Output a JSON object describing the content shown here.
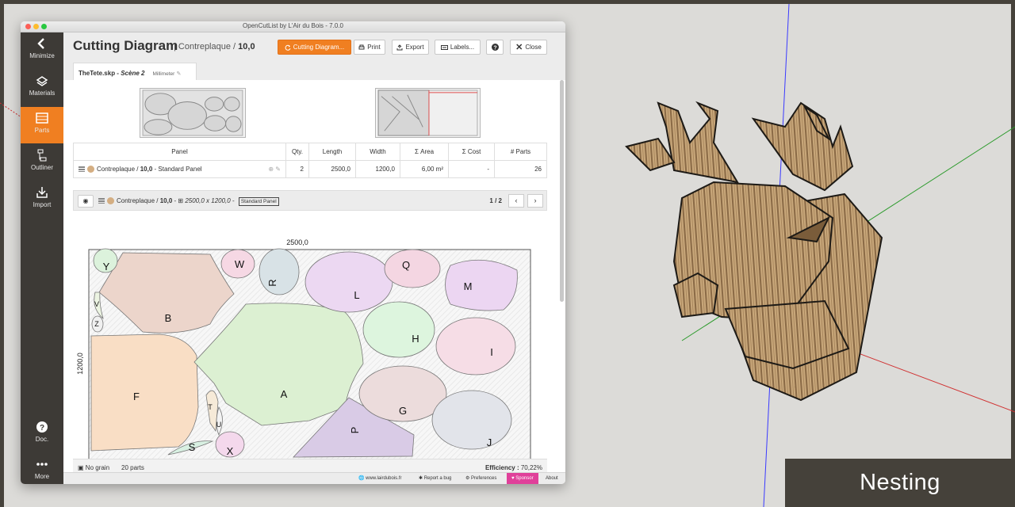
{
  "window": {
    "title": "OpenCutList by L'Air du Bois - 7.0.0"
  },
  "sidebar": [
    {
      "label": "Minimize",
      "icon": "chevron-left-icon"
    },
    {
      "label": "Materials",
      "icon": "materials-icon"
    },
    {
      "label": "Parts",
      "icon": "parts-list-icon",
      "active": true
    },
    {
      "label": "Outliner",
      "icon": "outliner-icon"
    },
    {
      "label": "Import",
      "icon": "import-icon"
    },
    {
      "label": "Doc.",
      "icon": "help-icon"
    },
    {
      "label": "More",
      "icon": "more-icon"
    }
  ],
  "header": {
    "title": "Cutting Diagram",
    "material": "Contreplaque",
    "thickness": "10,0",
    "buttons": {
      "cutting": "Cutting Diagram...",
      "print": "Print",
      "export": "Export",
      "labels": "Labels...",
      "help": "?",
      "close": "Close"
    }
  },
  "tab": {
    "file": "TheTete.skp -",
    "scene": "Scène 2",
    "unit": "Millimeter"
  },
  "summary": {
    "columns": [
      "Panel",
      "Qty.",
      "Length",
      "Width",
      "Σ Area",
      "Σ Cost",
      "# Parts"
    ],
    "row": {
      "material": "Contreplaque",
      "thickness": "10,0",
      "type": "Standard Panel",
      "qty": "2",
      "length": "2500,0",
      "width": "1200,0",
      "area": "6,00 m²",
      "cost": "-",
      "parts": "26"
    }
  },
  "sheet": {
    "material": "Contreplaque",
    "thickness": "10,0",
    "dims": "2500,0 x 1200,0",
    "type": "Standard Panel",
    "page": "1 / 2",
    "length_label": "2500,0",
    "width_label": "1200,0",
    "parts": {
      "A": "A",
      "B": "B",
      "F": "F",
      "G": "G",
      "H": "H",
      "I": "I",
      "J": "J",
      "L": "L",
      "M": "M",
      "P": "P",
      "Q": "Q",
      "R": "R",
      "S": "S",
      "T": "T",
      "U": "U",
      "V": "V",
      "W": "W",
      "X": "X",
      "Y": "Y",
      "Z": "Z"
    }
  },
  "stats": {
    "grain": "No grain",
    "parts": "20 parts",
    "efficiency_label": "Efficiency :",
    "efficiency": "70,22%"
  },
  "statusbar": {
    "site": "www.lairdubois.fr",
    "bug": "Report a bug",
    "prefs": "Preferences",
    "sponsor": "Sponsor",
    "about": "About"
  },
  "tag": "Nesting",
  "colors": {
    "accent": "#f07f21",
    "sidebar": "#3d3a36",
    "sponsor": "#e0409a"
  }
}
